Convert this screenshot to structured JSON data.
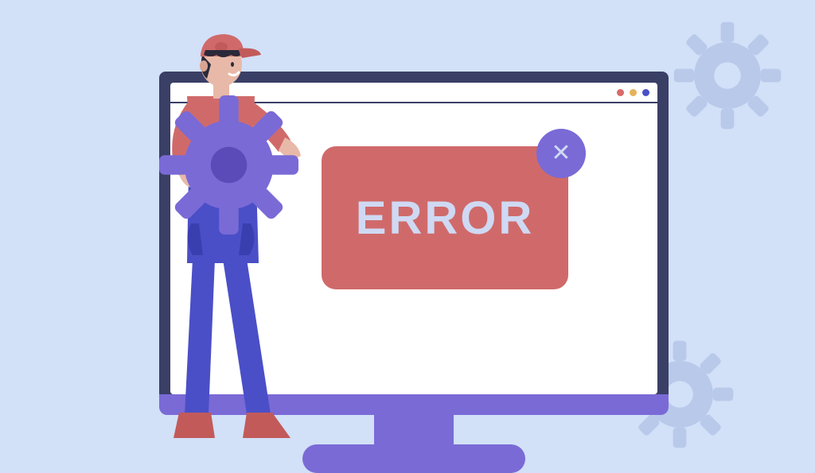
{
  "illustration": {
    "error_label": "ERROR",
    "close_symbol": "✕",
    "colors": {
      "background": "#d2e0f8",
      "monitor_bezel": "#3a3f66",
      "monitor_accent": "#7a6ad6",
      "error_card": "#d06a6a",
      "error_text": "#cfd9f3",
      "gear_held": "#7a6ad6",
      "gear_bg": "#b9c9ea",
      "person_shirt": "#d06a6a",
      "person_overalls": "#4a4fc7",
      "person_skin": "#e8b9a8",
      "person_boots": "#c25a5a",
      "dot_red": "#d86a6a",
      "dot_yellow": "#e6b25a",
      "dot_blue": "#4a4fc7"
    }
  }
}
